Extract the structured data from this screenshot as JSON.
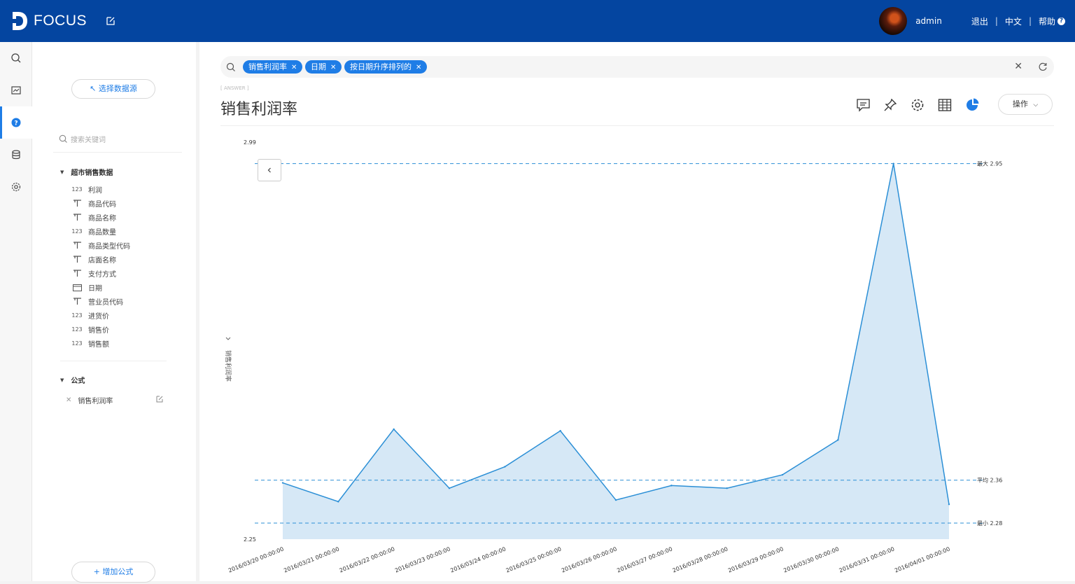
{
  "header": {
    "logo_text": "FOCUS",
    "user": "admin",
    "logout": "退出",
    "language": "中文",
    "help": "帮助",
    "separator": "|"
  },
  "rail": {
    "items": [
      {
        "icon": "search-icon"
      },
      {
        "icon": "board-icon"
      },
      {
        "icon": "question-icon",
        "active": true
      },
      {
        "icon": "database-icon"
      },
      {
        "icon": "gear-icon"
      }
    ]
  },
  "sidebar": {
    "select_source": "↖ 选择数据源",
    "search_placeholder": "搜索关键词",
    "group1": {
      "title": "超市销售数据",
      "fields": [
        {
          "type": "number",
          "label": "利润"
        },
        {
          "type": "text",
          "label": "商品代码"
        },
        {
          "type": "text",
          "label": "商品名称"
        },
        {
          "type": "number",
          "label": "商品数量"
        },
        {
          "type": "text",
          "label": "商品类型代码"
        },
        {
          "type": "text",
          "label": "店面名称"
        },
        {
          "type": "text",
          "label": "支付方式"
        },
        {
          "type": "date",
          "label": "日期"
        },
        {
          "type": "text",
          "label": "营业员代码"
        },
        {
          "type": "number",
          "label": "进货价"
        },
        {
          "type": "number",
          "label": "销售价"
        },
        {
          "type": "number",
          "label": "销售额"
        }
      ]
    },
    "group2": {
      "title": "公式",
      "formula": "销售利润率"
    },
    "add_formula": "+ 增加公式"
  },
  "search": {
    "chips": [
      "销售利润率",
      "日期",
      "按日期升序排列的"
    ]
  },
  "answer": {
    "tag": "[ ANSWER ]",
    "title": "销售利润率",
    "ops_label": "操作"
  },
  "chart_data": {
    "type": "area",
    "title": "",
    "ylabel": "销售利润率",
    "xlabel": "",
    "ylim": [
      2.25,
      2.99
    ],
    "y_ticks": [
      "2.99",
      "2.25"
    ],
    "x": [
      "2016/03/20 00:00:00",
      "2016/03/21 00:00:00",
      "2016/03/22 00:00:00",
      "2016/03/23 00:00:00",
      "2016/03/24 00:00:00",
      "2016/03/25 00:00:00",
      "2016/03/26 00:00:00",
      "2016/03/27 00:00:00",
      "2016/03/28 00:00:00",
      "2016/03/29 00:00:00",
      "2016/03/30 00:00:00",
      "2016/03/31 00:00:00",
      "2016/04/01 00:00:00"
    ],
    "values": [
      2.355,
      2.32,
      2.455,
      2.345,
      2.385,
      2.452,
      2.323,
      2.35,
      2.345,
      2.37,
      2.435,
      2.95,
      2.315
    ],
    "reference_lines": [
      {
        "label": "最大 2.95",
        "value": 2.95
      },
      {
        "label": "平均 2.36",
        "value": 2.36
      },
      {
        "label": "最小 2.28",
        "value": 2.28
      }
    ],
    "line_color": "#2b8fd6",
    "fill_color": "#d6e8f6",
    "grid": false
  }
}
